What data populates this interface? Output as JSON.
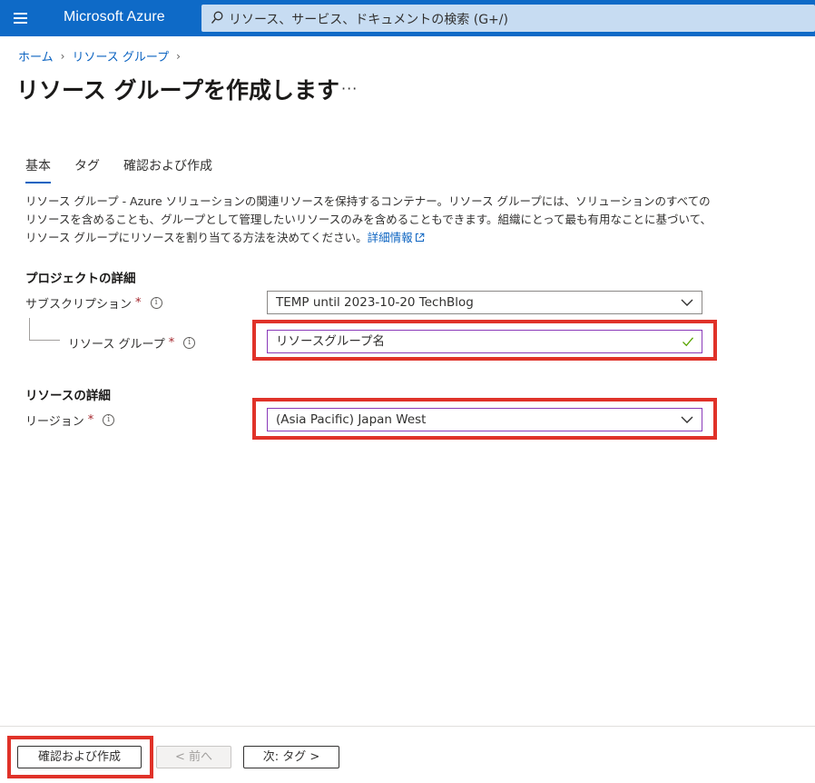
{
  "topbar": {
    "brand": "Microsoft Azure",
    "search_placeholder": "リソース、サービス、ドキュメントの検索 (G+/)"
  },
  "breadcrumb": {
    "items": [
      "ホーム",
      "リソース グループ"
    ]
  },
  "page": {
    "title": "リソース グループを作成します",
    "more": "···"
  },
  "tabs": [
    {
      "label": "基本",
      "active": true
    },
    {
      "label": "タグ",
      "active": false
    },
    {
      "label": "確認および作成",
      "active": false
    }
  ],
  "description": {
    "line1": "リソース グループ - Azure ソリューションの関連リソースを保持するコンテナー。リソース グループには、ソリューションのすべての",
    "line2": "リソースを含めることも、グループとして管理したいリソースのみを含めることもできます。組織にとって最も有用なことに基づいて、",
    "line3": "リソース グループにリソースを割り当てる方法を決めてください。",
    "learn_more": "詳細情報"
  },
  "project_details": {
    "heading": "プロジェクトの詳細",
    "subscription_label": "サブスクリプション",
    "subscription_value": "TEMP until 2023-10-20 TechBlog",
    "resource_group_label": "リソース グループ",
    "resource_group_value": "リソースグループ名"
  },
  "resource_details": {
    "heading": "リソースの詳細",
    "region_label": "リージョン",
    "region_value": "(Asia Pacific) Japan West"
  },
  "footer": {
    "review_create": "確認および作成",
    "previous": "< 前へ",
    "next": "次: タグ >"
  },
  "required_mark": "*",
  "info_mark": "i",
  "colors": {
    "topbar": "#0e6ac7",
    "link": "#0b63c1",
    "highlight_frame": "#e03229",
    "focused_border": "#8a3ab9",
    "valid_check": "#57a300"
  }
}
